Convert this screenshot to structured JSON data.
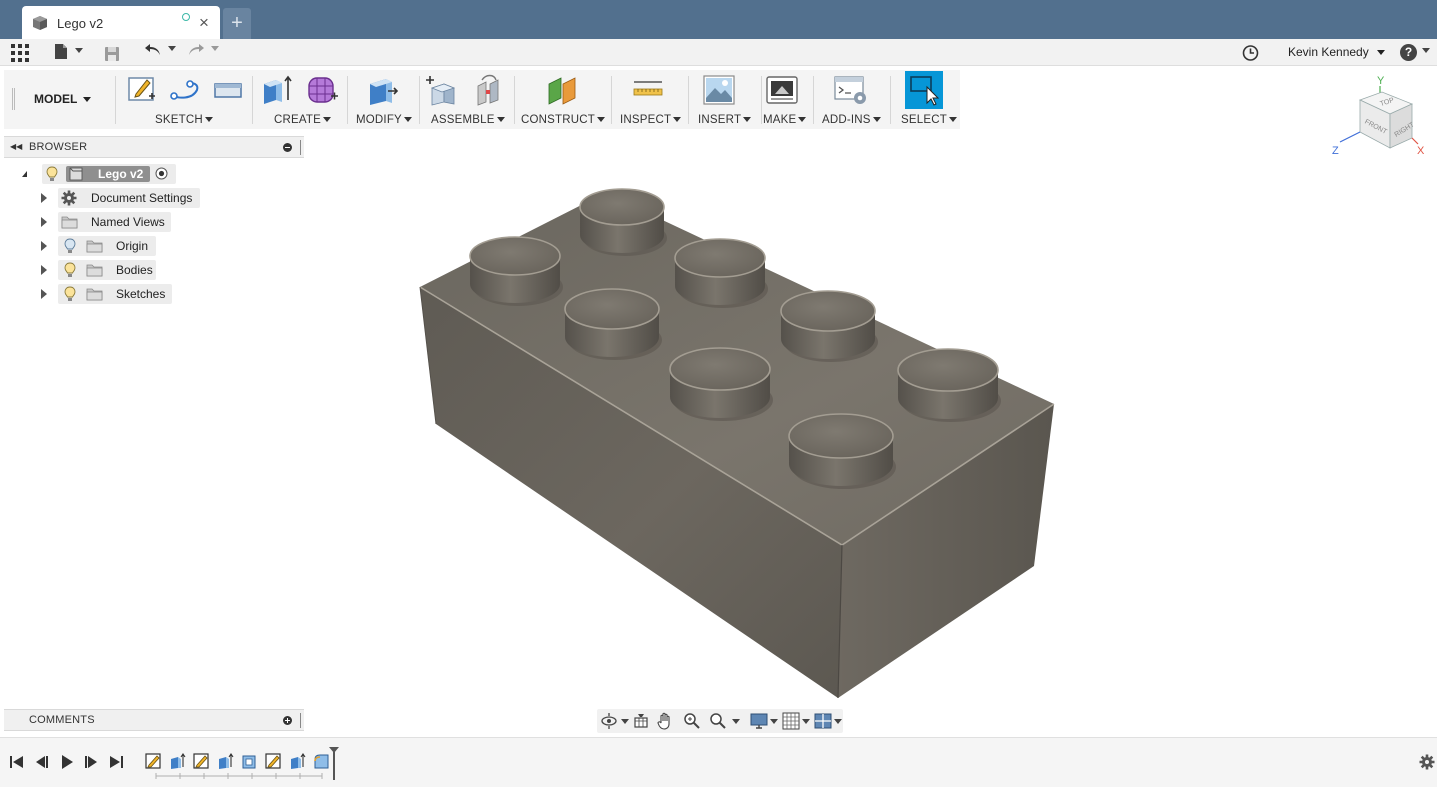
{
  "app": {
    "document_tab": {
      "title": "Lego v2",
      "close_glyph": "×"
    },
    "new_tab_glyph": "+"
  },
  "quick_access": {
    "user_name": "Kevin Kennedy",
    "help_glyph": "?"
  },
  "ribbon": {
    "workspace": "MODEL",
    "groups": [
      {
        "label": "SKETCH"
      },
      {
        "label": "CREATE"
      },
      {
        "label": "MODIFY"
      },
      {
        "label": "ASSEMBLE"
      },
      {
        "label": "CONSTRUCT"
      },
      {
        "label": "INSPECT"
      },
      {
        "label": "INSERT"
      },
      {
        "label": "MAKE"
      },
      {
        "label": "ADD-INS"
      },
      {
        "label": "SELECT"
      }
    ]
  },
  "browser": {
    "title": "BROWSER",
    "root": "Lego v2",
    "items": [
      {
        "label": "Document Settings",
        "icon": "gear-icon"
      },
      {
        "label": "Named Views",
        "icon": "folder-icon"
      },
      {
        "label": "Origin",
        "icon": "folder-icon"
      },
      {
        "label": "Bodies",
        "icon": "folder-icon"
      },
      {
        "label": "Sketches",
        "icon": "folder-icon"
      }
    ]
  },
  "comments": {
    "title": "COMMENTS"
  },
  "viewcube": {
    "top": "TOP",
    "front": "FRONT",
    "right": "RIGHT",
    "axis_x": "X",
    "axis_y": "Y",
    "axis_z": "Z"
  },
  "colors": {
    "tab_bar": "#52708e",
    "select_accent": "#0696d7",
    "brick_top": "#77726a",
    "brick_front": "#67625b",
    "brick_right": "#5c5851"
  },
  "timeline": {
    "features": [
      "sketch",
      "extrude",
      "sketch",
      "extrude",
      "shell",
      "sketch",
      "extrude",
      "fillet"
    ]
  }
}
